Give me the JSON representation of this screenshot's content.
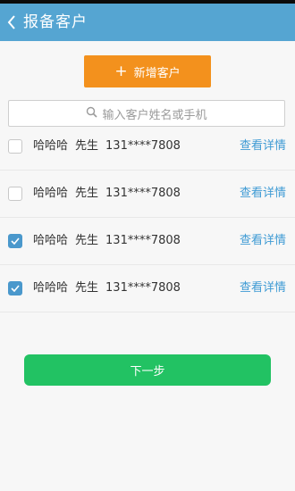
{
  "header": {
    "title": "报备客户"
  },
  "add_button": {
    "label": "新增客户"
  },
  "search": {
    "placeholder": "输入客户姓名或手机"
  },
  "customers": [
    {
      "name": "哈哈哈",
      "title": "先生",
      "phone": "131****7808",
      "detail_label": "查看详情",
      "checked": false
    },
    {
      "name": "哈哈哈",
      "title": "先生",
      "phone": "131****7808",
      "detail_label": "查看详情",
      "checked": false
    },
    {
      "name": "哈哈哈",
      "title": "先生",
      "phone": "131****7808",
      "detail_label": "查看详情",
      "checked": true
    },
    {
      "name": "哈哈哈",
      "title": "先生",
      "phone": "131****7808",
      "detail_label": "查看详情",
      "checked": true
    }
  ],
  "next_button": {
    "label": "下一步"
  },
  "colors": {
    "header": "#55a5d2",
    "add_button": "#f3911d",
    "next_button": "#22c263",
    "link": "#3f9bd4",
    "checkbox_checked": "#4a98cc"
  }
}
